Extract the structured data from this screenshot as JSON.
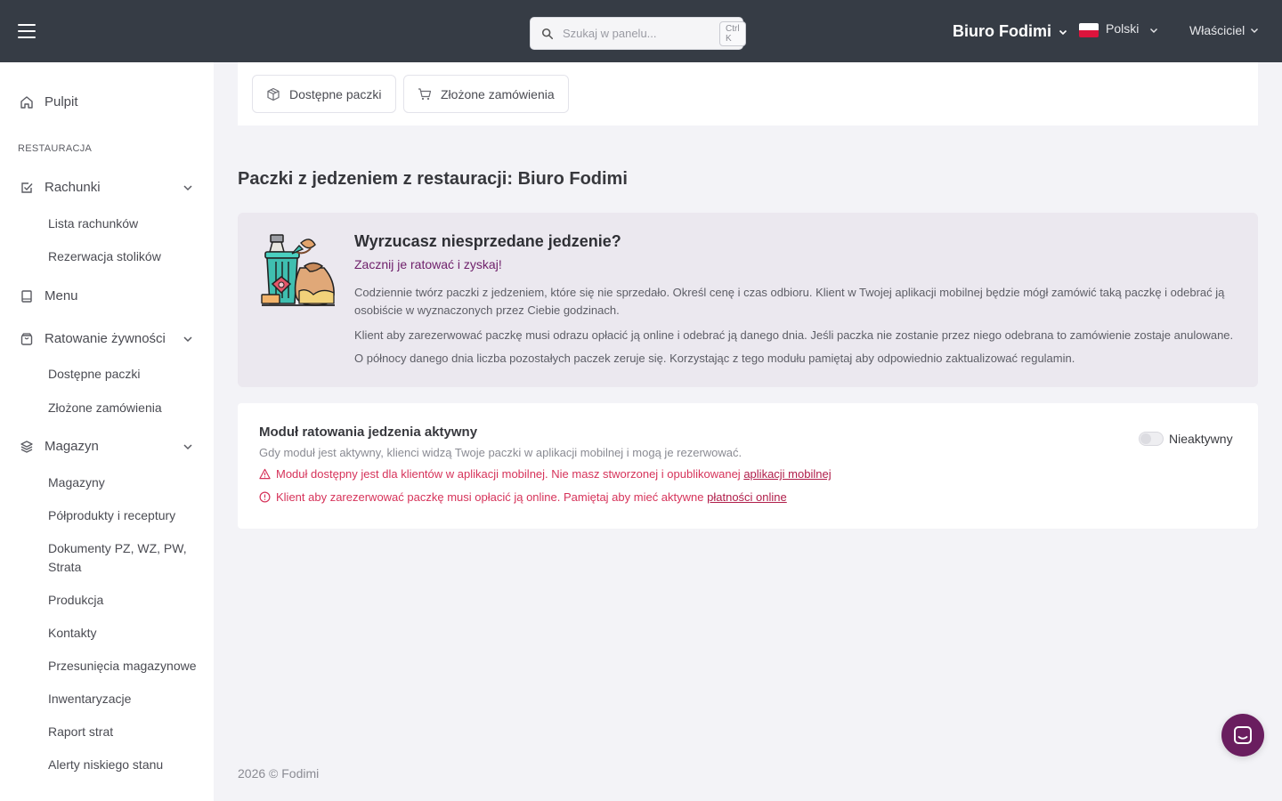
{
  "topbar": {
    "search_placeholder": "Szukaj w panelu...",
    "search_shortcut": "Ctrl K",
    "restaurant_name": "Biuro Fodimi",
    "language": "Polski",
    "user_role": "Właściciel"
  },
  "sidebar": {
    "dashboard": "Pulpit",
    "section_restaurant": "RESTAURACJA",
    "bills": "Rachunki",
    "bills_list": "Lista rachunków",
    "table_reservation": "Rezerwacja stolików",
    "menu": "Menu",
    "food_rescue": "Ratowanie żywności",
    "available_packages": "Dostępne paczki",
    "placed_orders": "Złożone zamówienia",
    "warehouse": "Magazyn",
    "warehouses": "Magazyny",
    "semi_products": "Półprodukty i receptury",
    "documents": "Dokumenty PZ, WZ, PW, Strata",
    "production": "Produkcja",
    "contacts": "Kontakty",
    "transfers": "Przesunięcia magazynowe",
    "inventory": "Inwentaryzacje",
    "loss_report": "Raport strat",
    "low_stock_alerts": "Alerty niskiego stanu"
  },
  "tabs": {
    "available_packages": "Dostępne paczki",
    "placed_orders": "Złożone zamówienia"
  },
  "page_title": "Paczki z jedzeniem z restauracji: Biuro Fodimi",
  "promo": {
    "title": "Wyrzucasz niesprzedane jedzenie?",
    "subtitle": "Zacznij je ratować i zyskaj!",
    "p1": "Codziennie twórz paczki z jedzeniem, które się nie sprzedało. Określ cenę i czas odbioru. Klient w Twojej aplikacji mobilnej będzie mógł zamówić taką paczkę i odebrać ją osobiście w wyznaczonych przez Ciebie godzinach.",
    "p2": "Klient aby zarezerwować paczkę musi odrazu opłacić ją online i odebrać ją danego dnia. Jeśli paczka nie zostanie przez niego odebrana to zamówienie zostaje anulowane.",
    "p3": "O północy danego dnia liczba pozostałych paczek zeruje się. Korzystając z tego modułu pamiętaj aby odpowiednio zaktualizować regulamin."
  },
  "module": {
    "title": "Moduł ratowania jedzenia aktywny",
    "description": "Gdy moduł jest aktywny, klienci widzą Twoje paczki w aplikacji mobilnej i mogą je rezerwować.",
    "warning1_text": "Moduł dostępny jest dla klientów w aplikacji mobilnej. Nie masz stworzonej i opublikowanej",
    "warning1_link": "aplikacji mobilnej",
    "warning2_text": "Klient aby zarezerwować paczkę musi opłacić ją online. Pamiętaj aby mieć aktywne",
    "warning2_link": "płatności online",
    "toggle_label": "Nieaktywny",
    "toggle_state": "off"
  },
  "footer": "2026 © Fodimi",
  "colors": {
    "topbar": "#363c45",
    "accent": "#6a1e5f",
    "warning": "#d6335a"
  }
}
